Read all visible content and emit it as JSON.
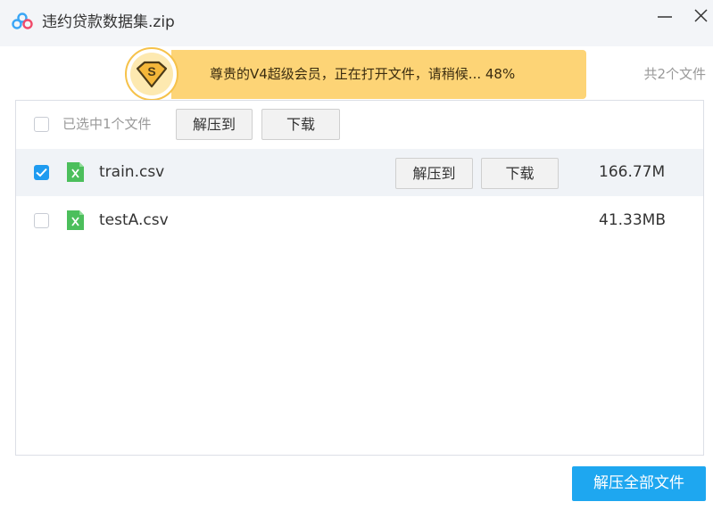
{
  "window": {
    "title": "违约贷款数据集.zip",
    "app_icon": "baidu-netdisk-cloud-icon",
    "minimize_icon": "minimize-icon",
    "close_icon": "close-icon"
  },
  "banner": {
    "text": "尊贵的V4超级会员，正在打开文件，请稍候... 48%",
    "badge_letter": "S",
    "progress_percent": 48,
    "background": "#fdd476"
  },
  "summary": {
    "file_count": "共2个文件"
  },
  "toolbar": {
    "selected_label": "已选中1个文件",
    "extract_label": "解压到",
    "download_label": "下载"
  },
  "files": [
    {
      "name": "train.csv",
      "size": "166.77M",
      "checked": true,
      "icon": "csv-file-icon",
      "extract_label": "解压到",
      "download_label": "下载"
    },
    {
      "name": "testA.csv",
      "size": "41.33MB",
      "checked": false,
      "icon": "csv-file-icon"
    }
  ],
  "footer": {
    "extract_all_label": "解压全部文件"
  },
  "colors": {
    "accent": "#1ea7f0",
    "checkbox_checked": "#1e9bf0",
    "file_icon_green": "#4cbf5c",
    "selected_row_bg": "#f0f3f7"
  }
}
